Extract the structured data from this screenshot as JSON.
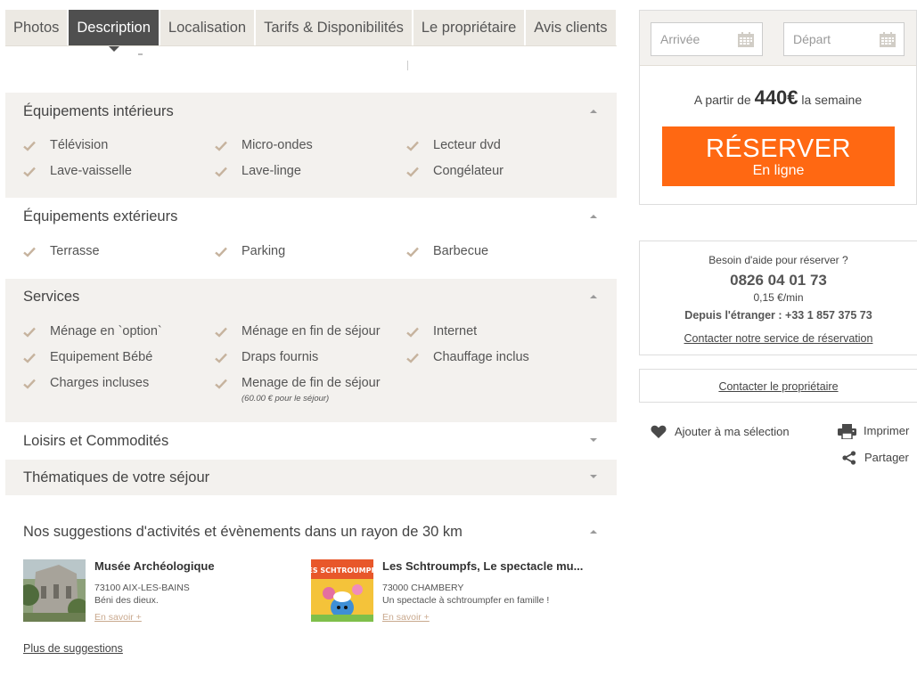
{
  "tabs": [
    {
      "label": "Photos",
      "active": false
    },
    {
      "label": "Description",
      "active": true
    },
    {
      "label": "Localisation",
      "active": false
    },
    {
      "label": "Tarifs & Disponibilités",
      "active": false
    },
    {
      "label": "Le propriétaire",
      "active": false
    },
    {
      "label": "Avis clients",
      "active": false
    }
  ],
  "sections": {
    "interieurs": {
      "title": "Équipements intérieurs",
      "expanded": true,
      "items": [
        "Télévision",
        "Micro-ondes",
        "Lecteur dvd",
        "Lave-vaisselle",
        "Lave-linge",
        "Congélateur"
      ]
    },
    "exterieurs": {
      "title": "Équipements extérieurs",
      "expanded": true,
      "items": [
        "Terrasse",
        "Parking",
        "Barbecue"
      ]
    },
    "services": {
      "title": "Services",
      "expanded": true,
      "items": [
        "Ménage en `option`",
        "Ménage en fin de séjour",
        "Internet",
        "Equipement Bébé",
        "Draps fournis",
        "Chauffage inclus",
        "Charges incluses",
        "Menage de fin de séjour"
      ],
      "note": "(60.00 € pour le séjour)"
    },
    "loisirs": {
      "title": "Loisirs et Commodités",
      "expanded": false
    },
    "thematiques": {
      "title": "Thématiques de votre séjour",
      "expanded": false
    }
  },
  "suggestions": {
    "title": "Nos suggestions d'activités et évènements dans un rayon de 30 km",
    "items": [
      {
        "name": "Musée Archéologique",
        "city": "73100 AIX-LES-BAINS",
        "desc": "Béni des dieux.",
        "more": "En savoir +"
      },
      {
        "name": "Les Schtroumpfs, Le spectacle mu...",
        "city": "73000 CHAMBERY",
        "desc": "Un spectacle à schtroumpfer en famille !",
        "more": "En savoir +",
        "image_text": "LES SCHTROUMPFS"
      }
    ],
    "more_link": "Plus de suggestions"
  },
  "booking": {
    "arrival_placeholder": "Arrivée",
    "departure_placeholder": "Départ",
    "price_prefix": "A partir de",
    "price": "440€",
    "price_suffix": "la semaine",
    "reserve_label": "RÉSERVER",
    "reserve_sub": "En ligne",
    "accent_color": "#ff6812"
  },
  "help": {
    "title": "Besoin d'aide pour réserver ?",
    "phone": "0826 04 01 73",
    "rate": "0,15 €/min",
    "intl": "Depuis l'étranger : +33 1 857 375 73",
    "link": "Contacter notre service de réservation"
  },
  "owner_link": "Contacter le propriétaire",
  "actions": {
    "add_selection": "Ajouter à ma sélection",
    "print": "Imprimer",
    "share": "Partager"
  }
}
